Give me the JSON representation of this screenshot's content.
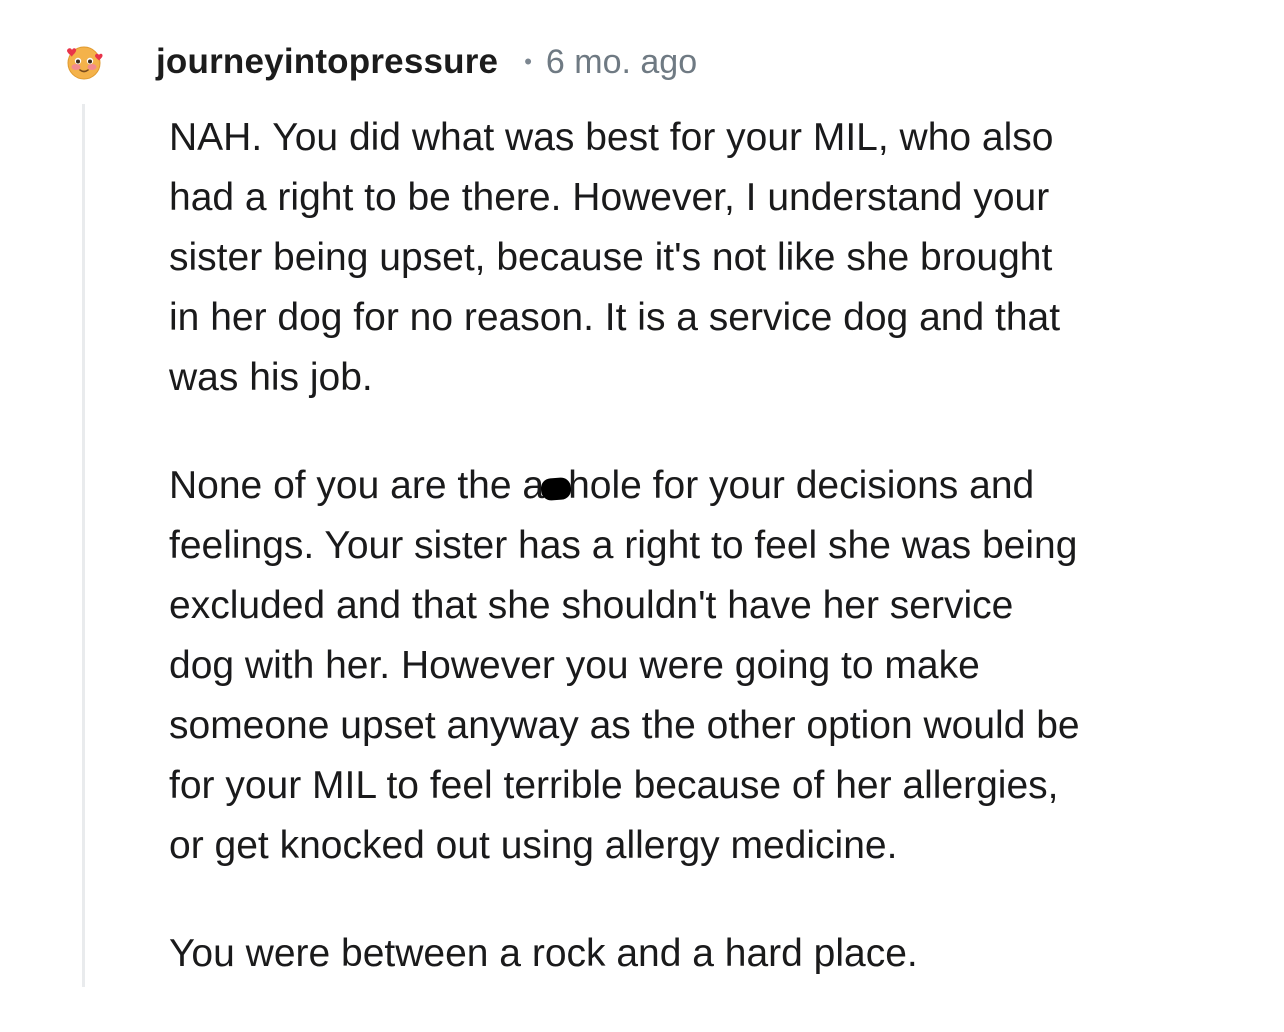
{
  "comment": {
    "avatar_icon": "blushing-emoji-avatar",
    "username": "journeyintopressure",
    "separator": "•",
    "timestamp": "6 mo. ago",
    "paragraphs": [
      {
        "lines": [
          "NAH. You did what was best for your MIL, who also",
          "had a right to be there. However, I understand your",
          "sister being upset, because it's not like she brought",
          "in her dog for no reason. It is a service dog and that",
          "was his job."
        ]
      },
      {
        "line1_before": "None of you are the a",
        "line1_after": "hole for your decisions and",
        "lines": [
          "feelings. Your sister has a right to feel she was being",
          "excluded and that she shouldn't have her service",
          "dog with her. However you were going to make",
          "someone upset anyway as the other option would be",
          "for your MIL to feel terrible because of her allergies,",
          "or get knocked out using allergy medicine."
        ]
      },
      {
        "lines": [
          "You were between a rock and a hard place."
        ]
      }
    ]
  }
}
